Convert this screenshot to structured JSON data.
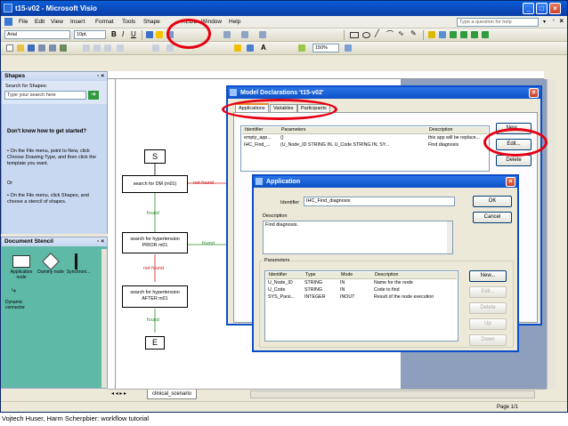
{
  "window": {
    "title": "t15-v02 - Microsoft Visio"
  },
  "menu": {
    "items": [
      "File",
      "Edit",
      "View",
      "Insert",
      "Format",
      "Tools",
      "Shape",
      "XEDL",
      "Window",
      "Help"
    ],
    "help_placeholder": "Type a question for help"
  },
  "toolbar": {
    "font": "Arial",
    "font_size": "10pt.",
    "zoom": "150%"
  },
  "shapes_pane": {
    "title": "Shapes",
    "search_label": "Search for Shapes:",
    "search_placeholder": "Type your search here",
    "help_title": "Don't know how to get started?",
    "help_items": [
      "On the File menu, point to New, click Choose Drawing Type, and then click the template you want.",
      "Or",
      "On the File menu, click Shapes, and choose a stencil of shapes."
    ]
  },
  "stencil_pane": {
    "title": "Document Stencil",
    "items": [
      "Application node",
      "Dummy node",
      "Synchroni...",
      "Dynamic connector"
    ]
  },
  "flowchart": {
    "start": "S",
    "end": "E",
    "node1": "search for DM (m01)",
    "node2": "search for hypertension PRIOR m01",
    "node3": "search for hypertension AFTER m01",
    "found1": "found",
    "found2": "found",
    "found3": "found",
    "not_found1": "not found",
    "not_found2": "not found"
  },
  "model_dialog": {
    "title": "Model Declarations 't15-v02'",
    "tabs": [
      "Applications",
      "Variables",
      "Participants"
    ],
    "columns": [
      "Identifier",
      "Parameters",
      "Description"
    ],
    "rows": [
      [
        "empty_app...",
        "()",
        "this app will be replace..."
      ],
      [
        "IHC_Find_...",
        "(U_Node_ID STRING IN, U_Code STRING IN, SY...",
        "Find diagnosis"
      ]
    ],
    "buttons": [
      "New...",
      "Edit...",
      "Delete"
    ]
  },
  "app_dialog": {
    "title": "Application",
    "identifier_label": "Identifier",
    "identifier_value": "IHC_Find_diagnosis",
    "description_label": "Description",
    "description_value": "Find diagnosis.",
    "parameters_label": "Parameters",
    "param_columns": [
      "Identifier",
      "Type",
      "Mode",
      "Description"
    ],
    "params": [
      [
        "U_Node_ID",
        "STRING",
        "IN",
        "Name for the node"
      ],
      [
        "U_Code",
        "STRING",
        "IN",
        "Code to find"
      ],
      [
        "SYS_Parsi...",
        "INTEGER",
        "INOUT",
        "Result of the node execution"
      ]
    ],
    "ok": "OK",
    "cancel": "Cancel",
    "param_buttons": [
      "New...",
      "Edit...",
      "Delete",
      "Up",
      "Down"
    ]
  },
  "tabstrip": {
    "page_tab": "clinical_scenario"
  },
  "status": {
    "page": "Page 1/1"
  },
  "caption": "Vojtech Huser, Harm Scherpbier: workflow tutorial",
  "colors": {
    "highlight_oval": "#e60012",
    "xp_blue": "#0b4dc8",
    "found_color": "#2e8b2e",
    "not_found_color": "#d11a1a"
  }
}
